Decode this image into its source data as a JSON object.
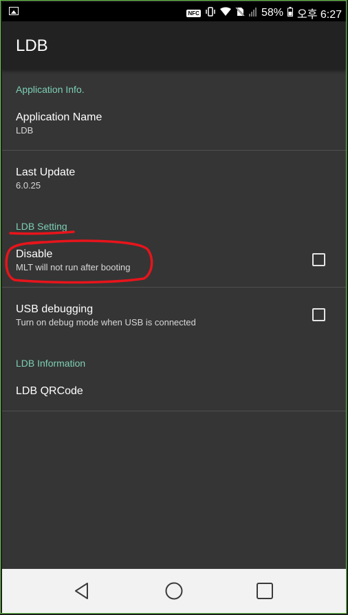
{
  "status_bar": {
    "nfc": "NFC",
    "battery_percent": "58%",
    "time": "오후 6:27"
  },
  "app_bar": {
    "title": "LDB"
  },
  "sections": {
    "app_info": {
      "header": "Application Info."
    },
    "ldb_setting": {
      "header": "LDB Setting"
    },
    "ldb_information": {
      "header": "LDB Information"
    }
  },
  "prefs": {
    "app_name": {
      "title": "Application Name",
      "summary": "LDB"
    },
    "last_update": {
      "title": "Last Update",
      "summary": "6.0.25"
    },
    "disable": {
      "title": "Disable",
      "summary": "MLT will not run after booting",
      "checked": false
    },
    "usb_debugging": {
      "title": "USB debugging",
      "summary": "Turn on debug mode when USB is connected",
      "checked": false
    },
    "qrcode": {
      "title": "LDB QRCode"
    }
  },
  "colors": {
    "accent": "#7dcfb6",
    "annotation": "#e8141b",
    "background": "#353535",
    "app_bar": "#222222"
  },
  "icons": [
    "image-icon",
    "nfc-icon",
    "vibrate-icon",
    "wifi-icon",
    "no-sim-icon",
    "signal-icon",
    "battery-icon",
    "back-icon",
    "home-icon",
    "recents-icon"
  ]
}
